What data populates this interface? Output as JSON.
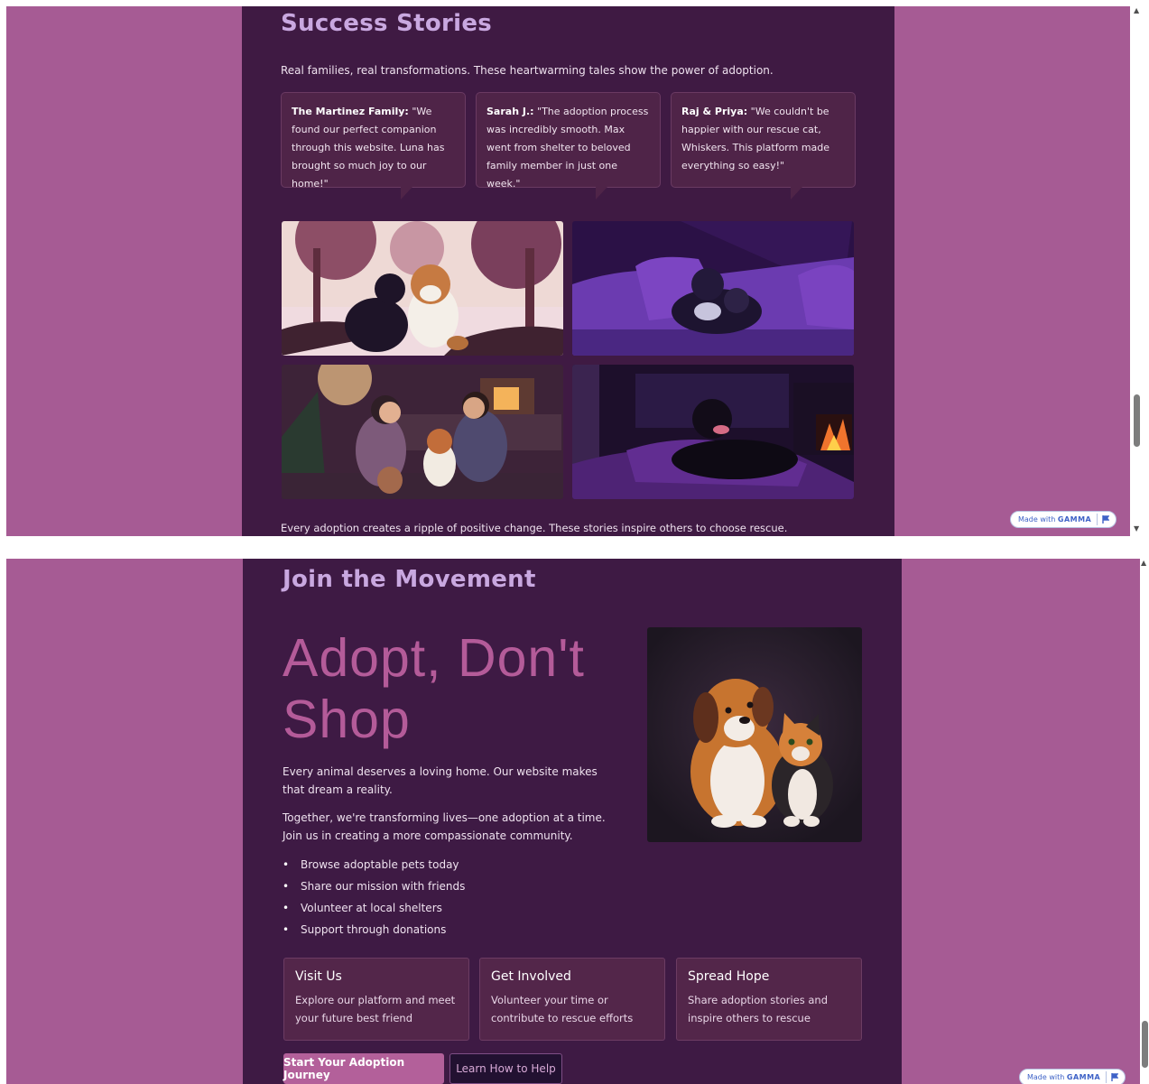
{
  "colors": {
    "page_background": "#a65b94",
    "card_background": "#3f1a43",
    "heading_color": "#c9a8e0",
    "accent": "#b45b99"
  },
  "section1": {
    "title": "Success Stories",
    "intro": "Real families, real transformations. These heartwarming tales show the power of adoption.",
    "testimonials": [
      {
        "name": "The Martinez Family:",
        "quote": " \"We found our perfect companion through this website. Luna has brought so much joy to our home!\""
      },
      {
        "name": "Sarah J.:",
        "quote": " \"The adoption process was incredibly smooth. Max went from shelter to beloved family member in just one week.\""
      },
      {
        "name": "Raj & Priya:",
        "quote": " \"We couldn't be happier with our rescue cat, Whiskers. This platform made everything so easy!\""
      }
    ],
    "footer_text": "Every adoption creates a ripple of positive change. These stories inspire others to choose rescue."
  },
  "section2": {
    "title": "Join the Movement",
    "hero_line1": "Adopt, Don't",
    "hero_line2": "Shop",
    "paragraph1": "Every animal deserves a loving home. Our website makes that dream a reality.",
    "paragraph2": "Together, we're transforming lives—one adoption at a time. Join us in creating a more compassionate community.",
    "bullets": [
      "Browse adoptable pets today",
      "Share our mission with friends",
      "Volunteer at local shelters",
      "Support through donations"
    ],
    "cards": [
      {
        "title": "Visit Us",
        "description": "Explore our platform and meet your future best friend"
      },
      {
        "title": "Get Involved",
        "description": "Volunteer your time or contribute to rescue efforts"
      },
      {
        "title": "Spread Hope",
        "description": "Share adoption stories and inspire others to rescue"
      }
    ],
    "primary_button": "Start Your Adoption Journey",
    "secondary_button": "Learn How to Help"
  },
  "badge": {
    "prefix": "Made with",
    "brand": "GAMMA"
  },
  "icons": {
    "flag": "flag-icon",
    "scroll_up": "▲",
    "scroll_down": "▼"
  }
}
